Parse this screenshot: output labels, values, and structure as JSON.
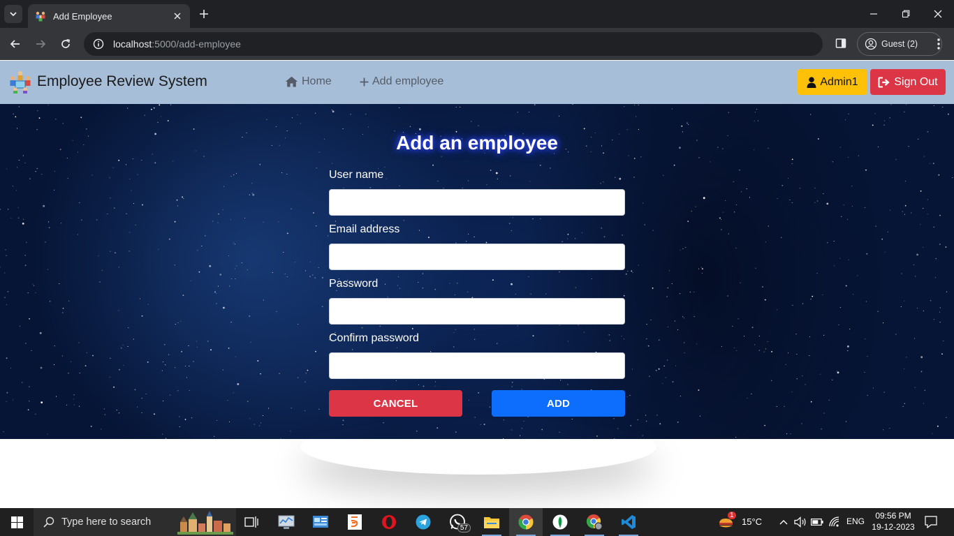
{
  "browser": {
    "tab_title": "Add Employee",
    "url_host": "localhost",
    "url_path": ":5000/add-employee",
    "profile_label": "Guest (2)"
  },
  "navbar": {
    "brand": "Employee Review System",
    "links": [
      {
        "label": "Home",
        "icon": "home-icon"
      },
      {
        "label": "Add employee",
        "icon": "plus-icon"
      }
    ],
    "admin_label": "Admin1",
    "signout_label": "Sign Out"
  },
  "form": {
    "title": "Add an employee",
    "fields": [
      {
        "label": "User name",
        "value": ""
      },
      {
        "label": "Email address",
        "value": ""
      },
      {
        "label": "Password",
        "value": ""
      },
      {
        "label": "Confirm password",
        "value": ""
      }
    ],
    "cancel_label": "CANCEL",
    "add_label": "ADD"
  },
  "taskbar": {
    "search_placeholder": "Type here to search",
    "whatsapp_badge": "57",
    "weather_badge": "1",
    "temperature": "15°C",
    "language": "ENG",
    "time": "09:56 PM",
    "date": "19-12-2023"
  },
  "colors": {
    "navbar_bg": "#a7bed9",
    "admin": "#ffc107",
    "signout": "#dc3545",
    "cancel": "#dc3545",
    "add": "#0d6efd",
    "title_glow": "#2d45ff"
  }
}
